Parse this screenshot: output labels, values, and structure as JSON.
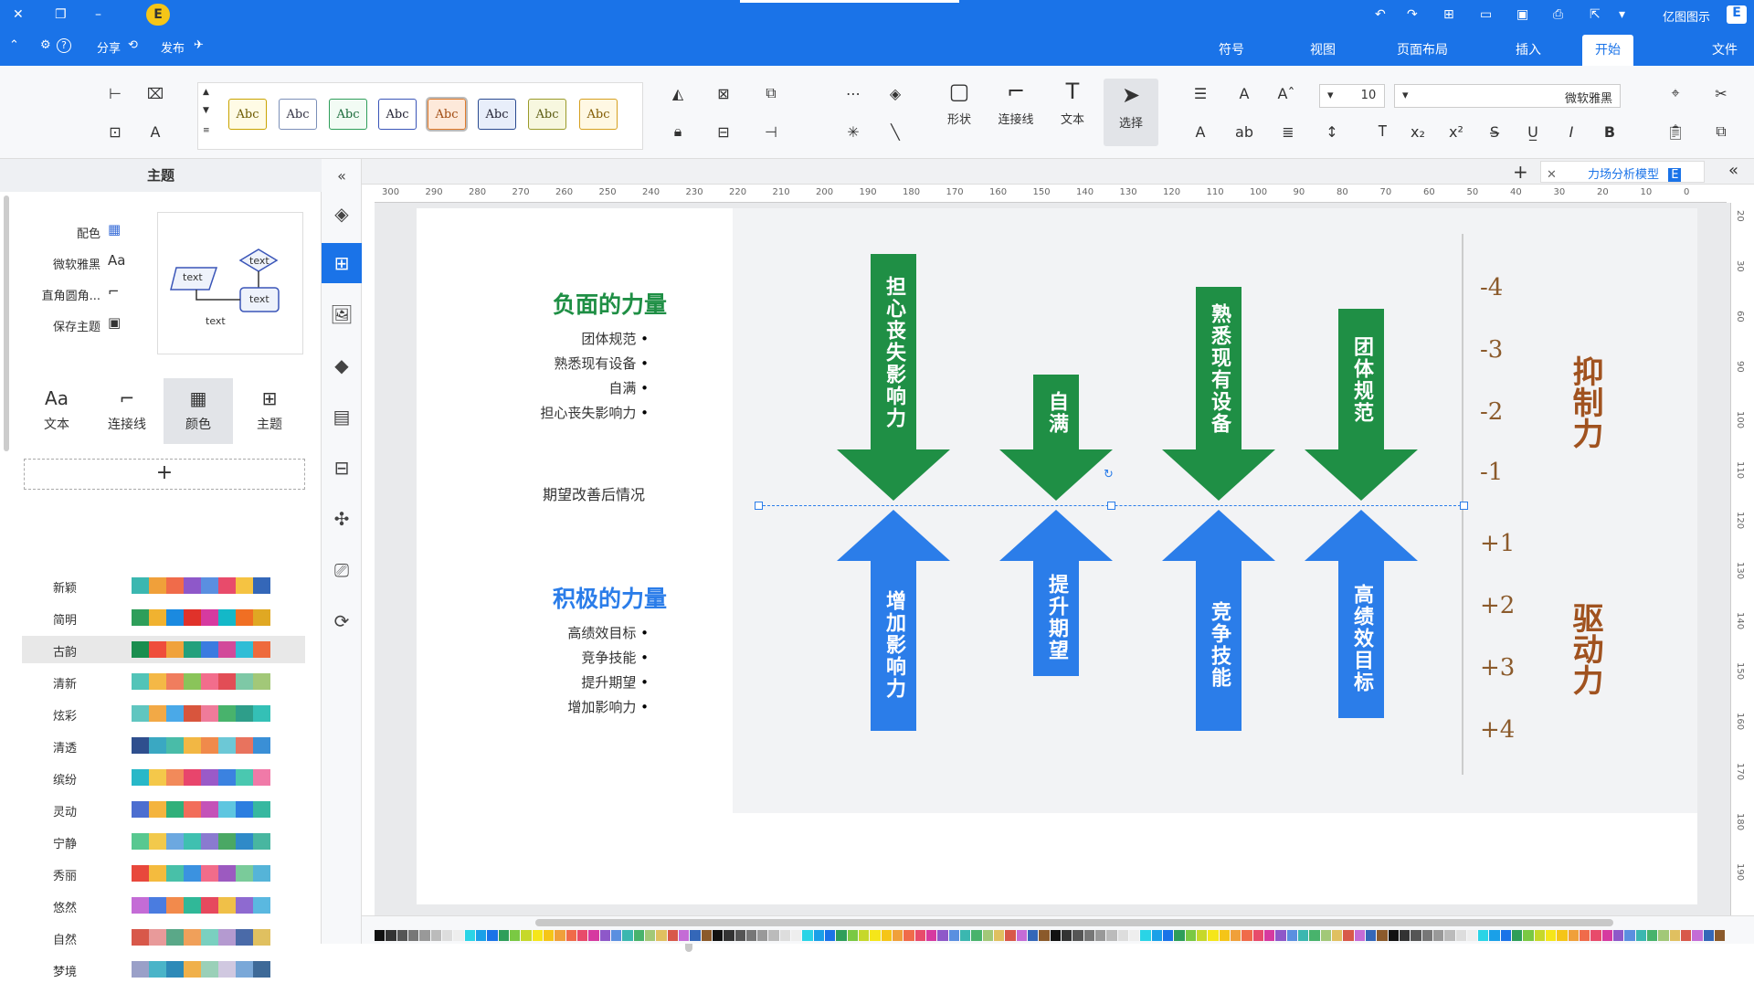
{
  "titlebar": {
    "app_name": "亿图图示",
    "app_badge": "E",
    "share_label": "分享",
    "publish_label": "发布",
    "help_label": "?"
  },
  "ribbon_tabs": [
    "文件",
    "开始",
    "插入",
    "页面布局",
    "视图",
    "符号"
  ],
  "toolbar": {
    "font_name": "微软雅黑",
    "font_size": "10",
    "tools": [
      "选择",
      "文本",
      "连接线",
      "形状"
    ],
    "style_sample": "Abc"
  },
  "left_panel": {
    "title": "主题",
    "options": [
      {
        "label": "配色",
        "icon": "palette-icon"
      },
      {
        "label": "微软雅黑",
        "icon": "font-icon"
      },
      {
        "label": "直角圆角...",
        "icon": "connector-icon"
      },
      {
        "label": "保存主题",
        "icon": "save-icon"
      }
    ],
    "preview_texts": [
      "text",
      "text",
      "text",
      "text"
    ],
    "tabs": [
      "主题",
      "颜色",
      "连接线",
      "文本"
    ],
    "add_label": "+",
    "palettes": [
      {
        "name": "新颖",
        "colors": [
          "#3bb7b0",
          "#f0a03a",
          "#f06b4a",
          "#8e58c9",
          "#5a8fe0",
          "#e84b6b",
          "#f5c342",
          "#3467b8"
        ]
      },
      {
        "name": "简明",
        "colors": [
          "#2e9e5a",
          "#f0b230",
          "#1b8ae0",
          "#e0322a",
          "#d63aa0",
          "#14b8c8",
          "#f06f23",
          "#e0a823"
        ]
      },
      {
        "name": "古韵",
        "colors": [
          "#1a8e4f",
          "#ef4d3b",
          "#f0a23b",
          "#23a07c",
          "#3b7be0",
          "#d24a9a",
          "#2fbdd6",
          "#ee6a3c"
        ]
      },
      {
        "name": "清新",
        "colors": [
          "#52c4b8",
          "#f4b846",
          "#f07d5e",
          "#8ac45a",
          "#f26d8c",
          "#e24d56",
          "#7ec8a6",
          "#a2c878"
        ]
      },
      {
        "name": "炫彩",
        "colors": [
          "#60c6c0",
          "#f2a946",
          "#4aa9e8",
          "#d8553d",
          "#ef7b9a",
          "#48b36c",
          "#2e9e8a",
          "#34c0b6"
        ]
      },
      {
        "name": "清透",
        "colors": [
          "#2f4f8e",
          "#3aa8c2",
          "#49bca8",
          "#f2b744",
          "#f08a4b",
          "#6cc8d6",
          "#e8735e",
          "#3a8fd6"
        ]
      },
      {
        "name": "缤纷",
        "colors": [
          "#28b8c8",
          "#f4c84a",
          "#f28a5a",
          "#e8456c",
          "#9a5ac8",
          "#3b82e0",
          "#4ac8b0",
          "#f07aa8"
        ]
      },
      {
        "name": "灵动",
        "colors": [
          "#4c6ed0",
          "#f4b43e",
          "#30b07a",
          "#f26d5a",
          "#c453b8",
          "#5ec6e0",
          "#2c7ee0",
          "#37b8a0"
        ]
      },
      {
        "name": "宁静",
        "colors": [
          "#58c890",
          "#f2c94c",
          "#6ca8e0",
          "#3fc0b0",
          "#8a7ad0",
          "#4aa864",
          "#2f8ac8",
          "#48b6a0"
        ]
      },
      {
        "name": "秀丽",
        "colors": [
          "#e8483c",
          "#f4bb3e",
          "#48c0a8",
          "#3b92e0",
          "#f26c8a",
          "#9c5ac0",
          "#7acb9a",
          "#55b4d8"
        ]
      },
      {
        "name": "悠然",
        "colors": [
          "#c46cd6",
          "#4a7ce0",
          "#f28a4c",
          "#30b898",
          "#e6495e",
          "#f0c048",
          "#8e6ad0",
          "#5ab8e0"
        ]
      },
      {
        "name": "自然",
        "colors": [
          "#d8584a",
          "#e89a9a",
          "#5aa888",
          "#f0a05a",
          "#7ad0c0",
          "#b49ad0",
          "#4a6aa8",
          "#e0c060"
        ]
      },
      {
        "name": "梦境",
        "colors": [
          "#9aa0c8",
          "#4ab4c8",
          "#2e8ab8",
          "#f0b04a",
          "#9ad0b8",
          "#d0c8e0",
          "#7aa8d8",
          "#3e6a98"
        ]
      }
    ]
  },
  "doc_tab": {
    "title": "力场分析模型"
  },
  "diagram": {
    "negative_title": "负面的力量",
    "negative_items": [
      "团体规范",
      "熟悉现有设备",
      "自满",
      "担心丧失影响力"
    ],
    "expected_label": "期望改善后情况",
    "positive_title": "积极的力量",
    "positive_items": [
      "高绩效目标",
      "竞争技能",
      "提升期望",
      "增加影响力"
    ],
    "arrows_top": [
      "担心丧失影响力",
      "自满",
      "熟悉现有设备",
      "团体规范"
    ],
    "arrows_bottom": [
      "增加影响力",
      "提升期望",
      "竞争技能",
      "高绩效目标"
    ],
    "scale_neg": [
      "-4",
      "-3",
      "-2",
      "-1"
    ],
    "scale_pos": [
      "+1",
      "+2",
      "+3",
      "+4"
    ],
    "label_restraining": "抑制力",
    "label_driving": "驱动力"
  },
  "ruler_top_ticks": [
    "300",
    "290",
    "280",
    "270",
    "260",
    "250",
    "240",
    "230",
    "220",
    "210",
    "200",
    "190",
    "180",
    "170",
    "160",
    "150",
    "140",
    "130",
    "120",
    "110",
    "100",
    "90",
    "80",
    "70",
    "60",
    "50",
    "40",
    "30",
    "20",
    "10",
    "0"
  ],
  "ruler_left_ticks": [
    "20",
    "30",
    "60",
    "90",
    "100",
    "110",
    "120",
    "130",
    "140",
    "150",
    "160",
    "170",
    "180",
    "190"
  ],
  "colors": {
    "accent": "#1a73e8",
    "green": "#1f8f45",
    "blue": "#2b7de9",
    "brown": "#a0521f"
  }
}
